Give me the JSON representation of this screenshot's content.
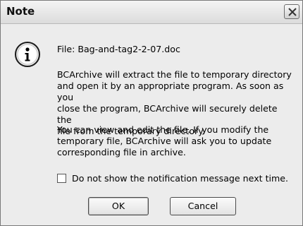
{
  "window": {
    "title": "Note",
    "close_icon": "close-x-icon"
  },
  "dialog": {
    "icon": "info-icon",
    "file_line": "File: Bag-and-tag2-2-07.doc",
    "paragraph1_lines": [
      "BCArchive will extract the file to temporary directory",
      "and open it by an appropriate program. As soon as you",
      "close the program, BCArchive will securely delete the",
      "file from the temporary directory."
    ],
    "paragraph2_lines": [
      "You can view and edit the file. If you modify the",
      "temporary file, BCArchive will ask you to update",
      "corresponding file in archive."
    ],
    "checkbox": {
      "label": "Do not show the notification message next time.",
      "checked": false
    },
    "buttons": {
      "ok": "OK",
      "cancel": "Cancel"
    }
  }
}
